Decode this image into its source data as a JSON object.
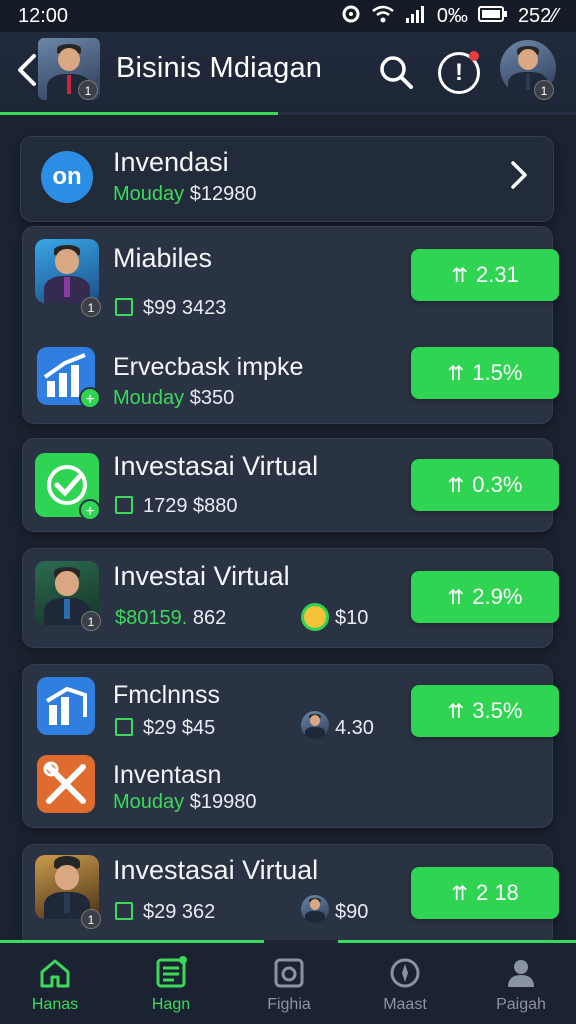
{
  "status_bar": {
    "time": "12:00",
    "network": "0‰",
    "battery": "252⁄⁄"
  },
  "header": {
    "title": "Bisinis Mdiagan"
  },
  "top_card": {
    "logo_text": "on",
    "title": "Invendasi",
    "sub_label": "Mouday",
    "sub_value": "$12980"
  },
  "cards": [
    {
      "title": "Miabiles",
      "amount": "$99 3423",
      "pill": "2.31",
      "badge": "1"
    },
    {
      "title": "Ervecbask impke",
      "sub_label": "Mouday",
      "sub_value": "$350",
      "pill": "1.5%"
    },
    {
      "title": "Investasai Virtual",
      "amount": "1729 $880",
      "pill": "0.3%"
    },
    {
      "title": "Investai Virtual",
      "amount_green": "$80159.",
      "amount_rest": " 862",
      "extra": "$10",
      "pill": "2.9%",
      "badge": "1"
    },
    {
      "title": "Fmclnnss",
      "amount": "$29 $45",
      "extra": "4.30",
      "pill": "3.5%"
    },
    {
      "title": "Inventasn",
      "sub_label": "Mouday",
      "sub_value": "$19980"
    },
    {
      "title": "Investasai Virtual",
      "amount": "$29 362",
      "extra": "$90",
      "pill": "2 18",
      "badge": "1"
    }
  ],
  "nav": [
    {
      "label": "Hanas",
      "icon": "home-icon",
      "color": "#3cd95a"
    },
    {
      "label": "Hagn",
      "icon": "list-icon",
      "color": "#3cd95a"
    },
    {
      "label": "Fighia",
      "icon": "camera-icon",
      "color": "#8a93a2"
    },
    {
      "label": "Maast",
      "icon": "compass-icon",
      "color": "#8a93a2"
    },
    {
      "label": "Paigah",
      "icon": "profile-icon",
      "color": "#8a93a2"
    }
  ],
  "colors": {
    "accent": "#3cd95a",
    "pill": "#2fd452",
    "background": "#1b2230",
    "card": "#2a3344"
  }
}
